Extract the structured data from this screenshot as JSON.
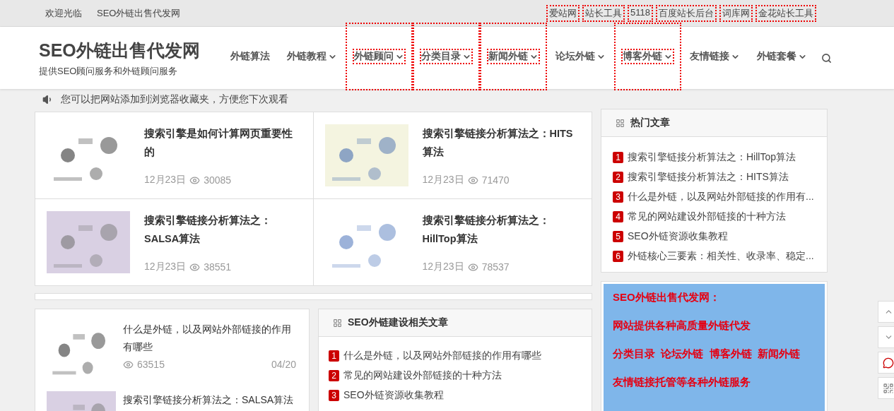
{
  "top_bar": {
    "greeting": "欢迎光临",
    "site_name": "SEO外链出售代发网",
    "links": [
      {
        "label": "爱站网",
        "outlined": true
      },
      {
        "label": "站长工具",
        "outlined": true
      },
      {
        "label": "5118",
        "outlined": true
      },
      {
        "label": "百度站长后台",
        "outlined": true
      },
      {
        "label": "词库网",
        "outlined": true
      },
      {
        "label": "金花站长工具",
        "outlined": true
      }
    ]
  },
  "header": {
    "logo": "SEO外链出售代发网",
    "tagline": "提供SEO顾问服务和外链顾问服务",
    "nav": [
      {
        "label": "外链算法",
        "has_menu": false,
        "outlined": false
      },
      {
        "label": "外链教程",
        "has_menu": true,
        "outlined": false
      },
      {
        "label": "外链顾问",
        "has_menu": true,
        "outlined": true
      },
      {
        "label": "分类目录",
        "has_menu": true,
        "outlined": true
      },
      {
        "label": "新闻外链",
        "has_menu": true,
        "outlined": true
      },
      {
        "label": "论坛外链",
        "has_menu": true,
        "outlined": false
      },
      {
        "label": "博客外链",
        "has_menu": true,
        "outlined": true
      },
      {
        "label": "友情链接",
        "has_menu": true,
        "outlined": false
      },
      {
        "label": "外链套餐",
        "has_menu": true,
        "outlined": false
      }
    ]
  },
  "notice": "您可以把网站添加到浏览器收藏夹，方便您下次观看",
  "featured": [
    {
      "title": "搜索引擎是如何计算网页重要性的",
      "date": "12月23日",
      "views": "30085"
    },
    {
      "title": "搜索引擎链接分析算法之：HITS算法",
      "date": "12月23日",
      "views": "71470"
    },
    {
      "title": "搜索引擎链接分析算法之：SALSA算法",
      "date": "12月23日",
      "views": "38551"
    },
    {
      "title": "搜索引擎链接分析算法之：HillTop算法",
      "date": "12月23日",
      "views": "78537"
    }
  ],
  "posts": [
    {
      "title": "什么是外链，以及网站外部链接的作用有哪些",
      "views": "63515",
      "date": "04/20"
    },
    {
      "title": "搜索引擎链接分析算法之：SALSA算法"
    }
  ],
  "related": {
    "title": "SEO外链建设相关文章",
    "items": [
      {
        "rank": "1",
        "title": "什么是外链，以及网站外部链接的作用有哪些"
      },
      {
        "rank": "2",
        "title": "常见的网站建设外部链接的十种方法"
      },
      {
        "rank": "3",
        "title": "SEO外链资源收集教程"
      }
    ]
  },
  "hot": {
    "title": "热门文章",
    "items": [
      {
        "rank": "1",
        "title": "搜索引擎链接分析算法之：HillTop算法"
      },
      {
        "rank": "2",
        "title": "搜索引擎链接分析算法之：HITS算法"
      },
      {
        "rank": "3",
        "title": "什么是外链，以及网站外部链接的作用有..."
      },
      {
        "rank": "4",
        "title": "常见的网站建设外部链接的十种方法"
      },
      {
        "rank": "5",
        "title": "SEO外链资源收集教程"
      },
      {
        "rank": "6",
        "title": "外链核心三要素：相关性、收录率、稳定..."
      }
    ]
  },
  "ad": {
    "lines": [
      "SEO外链出售代发网：",
      "网站提供各种高质量外链代发",
      "分类目录  论坛外链  博客外链  新闻外链",
      "友情链接托管等各种外链服务"
    ]
  }
}
